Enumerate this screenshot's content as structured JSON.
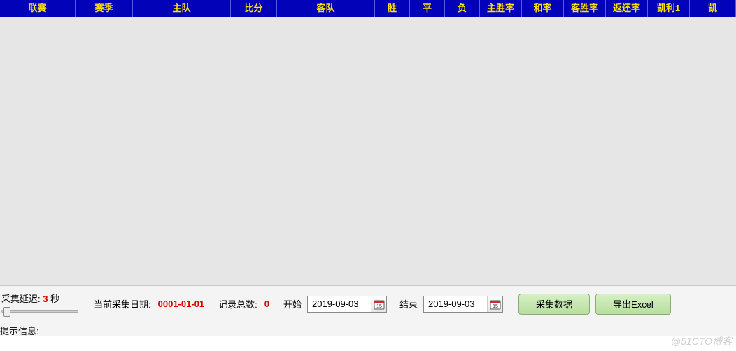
{
  "grid": {
    "columns": [
      "联赛",
      "赛季",
      "主队",
      "比分",
      "客队",
      "胜",
      "平",
      "负",
      "主胜率",
      "和率",
      "客胜率",
      "返还率",
      "凯利1",
      "凯"
    ],
    "rows": []
  },
  "footer": {
    "delay_label": "采集延迟:",
    "delay_value": "3",
    "delay_unit": "秒",
    "current_date_label": "当前采集日期:",
    "current_date_value": "0001-01-01",
    "record_count_label": "记录总数:",
    "record_count_value": "0",
    "start_label": "开始",
    "start_date": "2019-09-03",
    "end_label": "结束",
    "end_date": "2019-09-03",
    "collect_btn": "采集数据",
    "export_btn": "导出Excel"
  },
  "status": {
    "prefix": "提示信息:",
    "message": ""
  },
  "watermark": "@51CTO博客"
}
